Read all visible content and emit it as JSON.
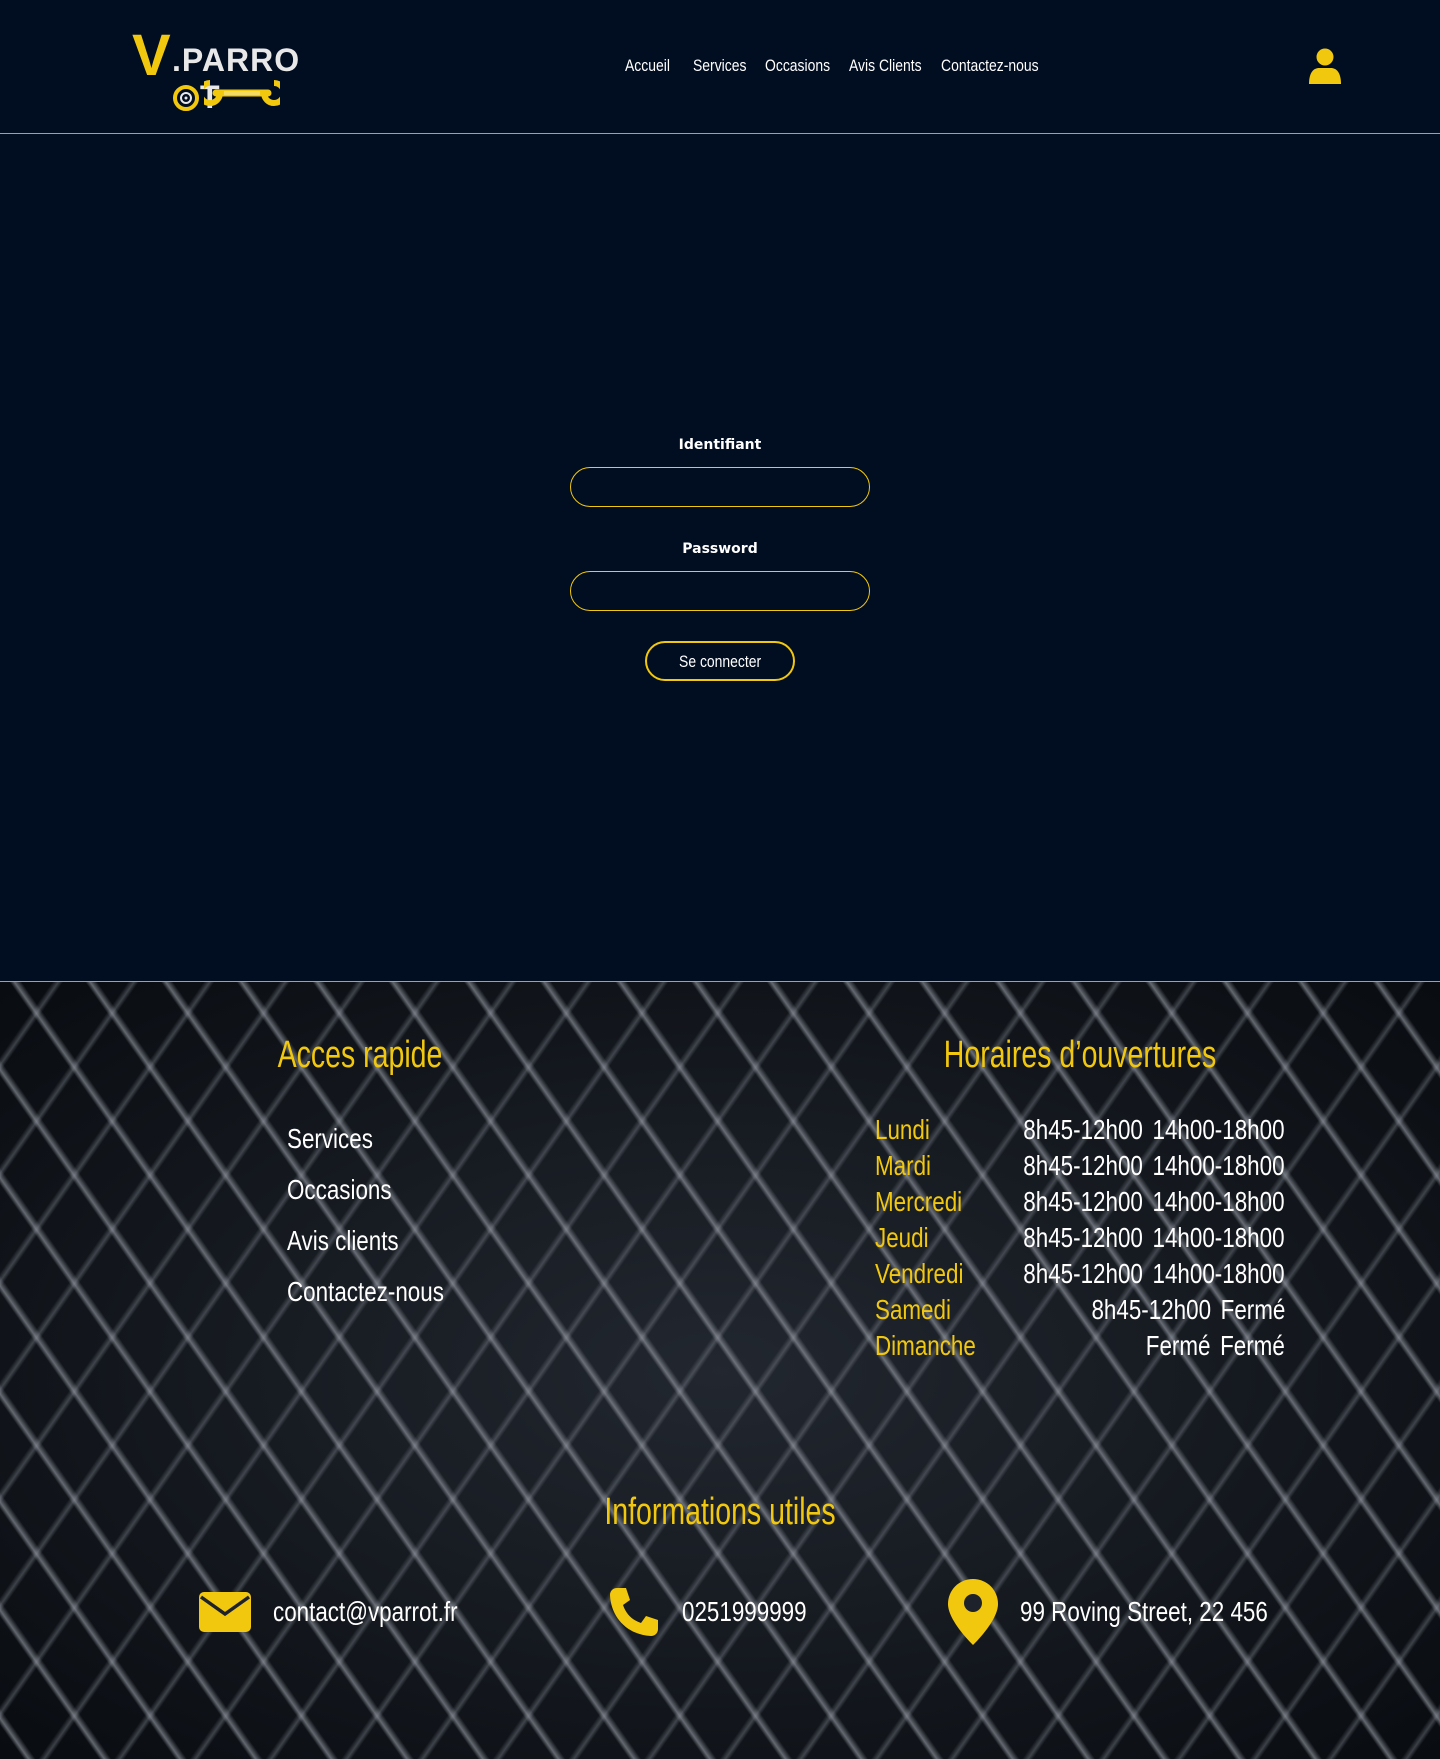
{
  "header": {
    "logo": {
      "initial": "V",
      "name": ".PARRO",
      "suffix": "T"
    },
    "nav": [
      {
        "label": "Accueil"
      },
      {
        "label": "Services"
      },
      {
        "label": "Occasions"
      },
      {
        "label": "Avis Clients"
      },
      {
        "label": "Contactez-nous"
      }
    ],
    "user_icon": "user-icon"
  },
  "login": {
    "identifiant_label": "Identifiant",
    "identifiant_value": "",
    "password_label": "Password",
    "password_value": "",
    "submit_label": "Se connecter"
  },
  "footer": {
    "quick_access": {
      "title": "Acces rapide",
      "links": [
        "Services",
        "Occasions",
        "Avis clients",
        "Contactez-nous"
      ]
    },
    "hours": {
      "title": "Horaires d’ouvertures",
      "rows": [
        {
          "day": "Lundi",
          "morning": "8h45-12h00",
          "afternoon": "14h00-18h00"
        },
        {
          "day": "Mardi",
          "morning": "8h45-12h00",
          "afternoon": "14h00-18h00"
        },
        {
          "day": "Mercredi",
          "morning": "8h45-12h00",
          "afternoon": "14h00-18h00"
        },
        {
          "day": "Jeudi",
          "morning": "8h45-12h00",
          "afternoon": "14h00-18h00"
        },
        {
          "day": "Vendredi",
          "morning": "8h45-12h00",
          "afternoon": "14h00-18h00"
        },
        {
          "day": "Samedi",
          "morning": "8h45-12h00",
          "afternoon": "Fermé"
        },
        {
          "day": "Dimanche",
          "morning": "Fermé",
          "afternoon": "Fermé"
        }
      ]
    },
    "info": {
      "title": "Informations utiles",
      "email": "contact@vparrot.fr",
      "phone": "0251999999",
      "address": "99 Roving Street, 22 456"
    }
  },
  "colors": {
    "background": "#010d21",
    "accent": "#f2c80f",
    "divider": "#c9a227",
    "text": "#ffffff"
  }
}
